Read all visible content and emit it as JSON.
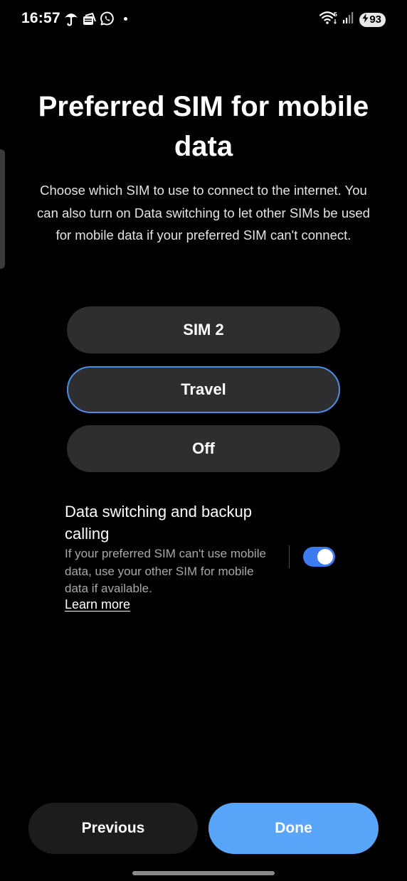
{
  "status_bar": {
    "time": "16:57",
    "left_icons": [
      "umbrella-icon",
      "stack-icon",
      "whatsapp-icon",
      "notification-dot"
    ],
    "right_icons": [
      "wifi-icon",
      "signal-icon"
    ],
    "wifi_badge": "5",
    "battery_level": "93",
    "battery_charging": true
  },
  "page": {
    "title": "Preferred SIM for mobile data",
    "description": "Choose which SIM to use to connect to the internet. You can also turn on Data switching to let other SIMs be used for mobile data if your preferred SIM can't connect."
  },
  "options": [
    {
      "label": "SIM 2",
      "selected": false
    },
    {
      "label": "Travel",
      "selected": true
    },
    {
      "label": "Off",
      "selected": false
    }
  ],
  "data_switching": {
    "title": "Data switching and backup calling",
    "description": "If your preferred SIM can't use mobile data, use your other SIM for mobile data if available.",
    "learn_more": "Learn more",
    "enabled": true
  },
  "footer": {
    "previous_label": "Previous",
    "done_label": "Done"
  },
  "colors": {
    "accent": "#3e7bf0",
    "done_button": "#58a5fa",
    "selected_border": "#4a8ee6",
    "option_bg": "#2e2e30",
    "background": "#000000"
  }
}
